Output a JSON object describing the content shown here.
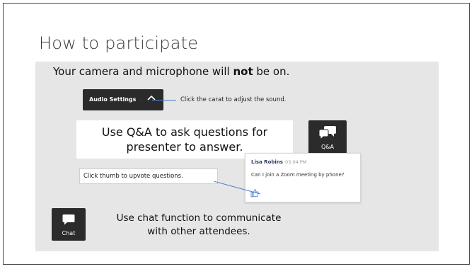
{
  "slide": {
    "title": "How to participate",
    "camera_notice": {
      "prefix": "Your camera and microphone will ",
      "emphasis": "not",
      "suffix": " be on."
    },
    "audio_settings": {
      "button_label": "Audio Settings",
      "icon": "caret-up-icon",
      "callout": "Click the carat to adjust the sound."
    },
    "qa": {
      "instruction": "Use Q&A to ask questions for presenter to answer.",
      "button_label": "Q&A",
      "icon": "qa-bubbles-icon"
    },
    "question_card": {
      "author": "Lisa Robins",
      "time": "03:04 PM",
      "question": "Can I join a Zoom meeting by phone?",
      "icon": "thumbs-up-icon"
    },
    "upvote_callout": "Click thumb to upvote questions.",
    "chat": {
      "button_label": "Chat",
      "icon": "chat-bubble-icon",
      "instruction": "Use chat function to communicate with other attendees."
    },
    "colors": {
      "content_bg": "#e6e6e6",
      "button_bg": "#2b2b2b",
      "callout_line": "#4a7ec8"
    }
  }
}
